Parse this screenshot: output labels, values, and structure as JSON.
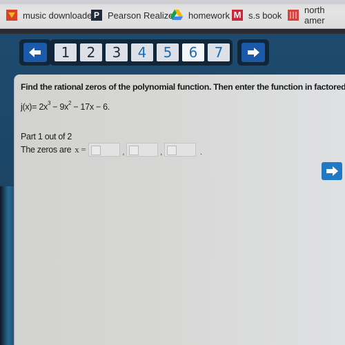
{
  "bookmarks": [
    {
      "label": "music downloader",
      "icon": "music-downloader-icon"
    },
    {
      "label": "Pearson Realize",
      "icon": "pearson-icon",
      "glyph": "P"
    },
    {
      "label": "homework",
      "icon": "google-drive-icon"
    },
    {
      "label": "s.s book",
      "icon": "mcgraw-hill-icon",
      "glyph": "M"
    },
    {
      "label": "north amer",
      "icon": "north-america-icon"
    }
  ],
  "navigation": {
    "prev_icon": "arrow-left-icon",
    "next_icon": "arrow-right-icon",
    "pages": [
      {
        "label": "1",
        "state": "visited"
      },
      {
        "label": "2",
        "state": "visited"
      },
      {
        "label": "3",
        "state": "visited"
      },
      {
        "label": "4",
        "state": "unvisited"
      },
      {
        "label": "5",
        "state": "unvisited"
      },
      {
        "label": "6",
        "state": "current"
      },
      {
        "label": "7",
        "state": "unvisited"
      }
    ]
  },
  "question": {
    "prompt": "Find the rational zeros of the polynomial function. Then enter the function in factored form.",
    "function": {
      "lhs": "j(x)= ",
      "term1": "2x",
      "exp1": "3",
      "term2": " − 9x",
      "exp2": "2",
      "rest": " − 17x − 6."
    },
    "part": "Part 1 out of 2",
    "zeros_label": "The zeros are",
    "x_equals": "x =",
    "answers": [
      "",
      "",
      ""
    ],
    "separator": ",",
    "terminator": "."
  },
  "colors": {
    "nav_blue": "#1a5aa8",
    "page_unvisited": "#1e6db3",
    "next_button": "#2178c4"
  }
}
